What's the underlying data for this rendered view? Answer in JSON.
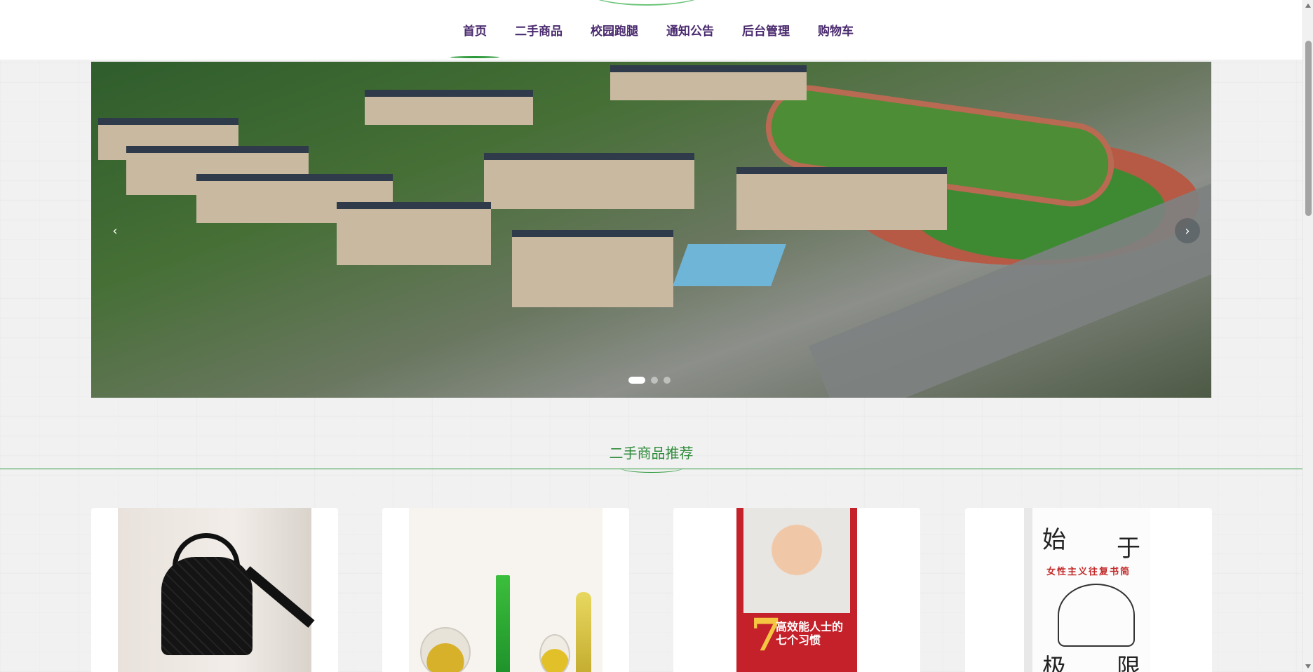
{
  "nav": {
    "items": [
      {
        "label": "首页",
        "active": true
      },
      {
        "label": "二手商品",
        "active": false
      },
      {
        "label": "校园跑腿",
        "active": false
      },
      {
        "label": "通知公告",
        "active": false
      },
      {
        "label": "后台管理",
        "active": false
      },
      {
        "label": "购物车",
        "active": false
      }
    ]
  },
  "carousel": {
    "prev_icon": "‹",
    "next_icon": "›",
    "slide_count": 3,
    "active_slide": 1
  },
  "section": {
    "title": "二手商品推荐"
  },
  "products": {
    "book1": {
      "number": "7",
      "title_line1": "高效能人士的",
      "title_line2": "七个习惯"
    },
    "book2": {
      "char_1": "始",
      "char_2": "于",
      "char_3": "极",
      "char_4": "限",
      "subtitle": "女性主义往复书简"
    }
  },
  "colors": {
    "accent": "#2e9a3c",
    "nav_text": "#4a2a6e"
  }
}
